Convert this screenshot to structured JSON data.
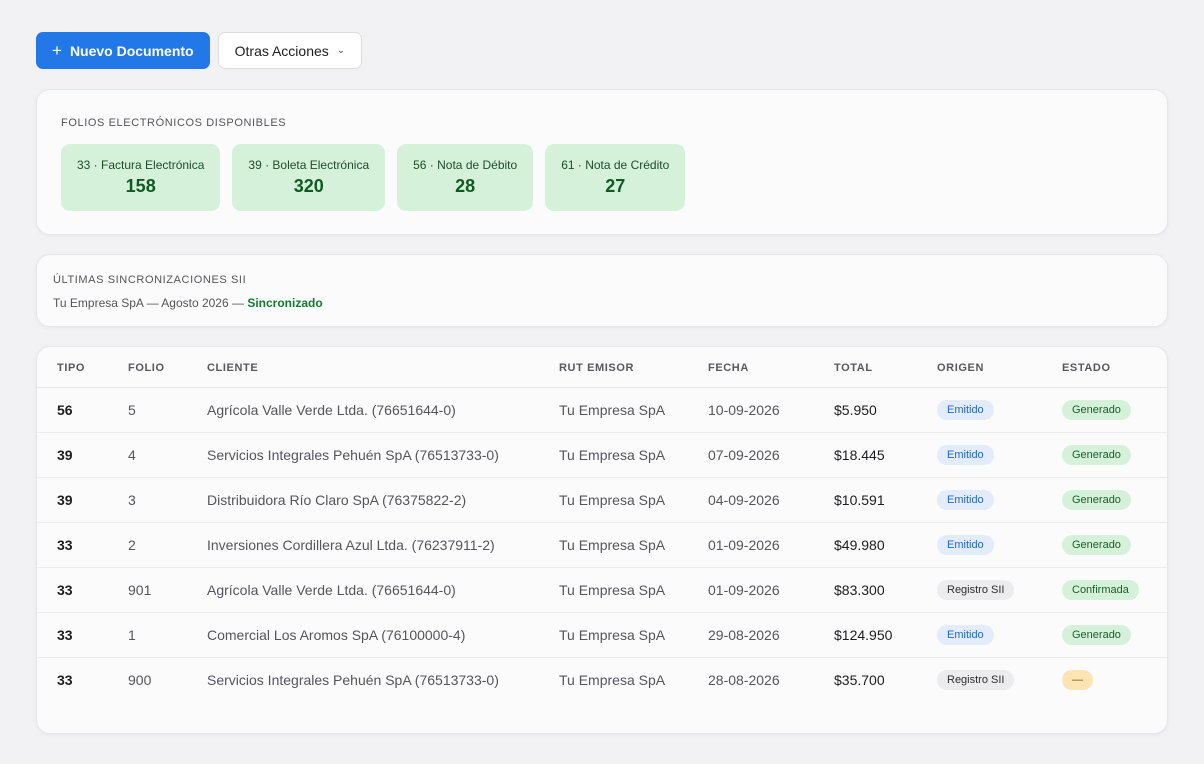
{
  "toolbar": {
    "new_document_icon": "plus-icon",
    "new_document_label": "Nuevo Documento",
    "other_actions_label": "Otras Acciones",
    "other_actions_icon": "chevron-down-icon"
  },
  "folios": {
    "title": "FOLIOS ELECTRÓNICOS DISPONIBLES",
    "items": [
      {
        "label": "33 · Factura Electrónica",
        "count": "158"
      },
      {
        "label": "39 · Boleta Electrónica",
        "count": "320"
      },
      {
        "label": "56 · Nota de Débito",
        "count": "28"
      },
      {
        "label": "61 · Nota de Crédito",
        "count": "27"
      }
    ]
  },
  "sync": {
    "title": "ÚLTIMAS SINCRONIZACIONES SII",
    "description": "Tu Empresa SpA — Agosto 2026 —",
    "status": "Sincronizado"
  },
  "table": {
    "headers": [
      "TIPO",
      "FOLIO",
      "CLIENTE",
      "RUT EMISOR",
      "FECHA",
      "TOTAL",
      "ORIGEN",
      "ESTADO"
    ],
    "rows": [
      {
        "tipo": "56",
        "folio": "5",
        "cliente": "Agrícola Valle Verde Ltda. (76651644-0)",
        "rut_emisor": "Tu Empresa SpA",
        "fecha": "10-09-2026",
        "total": "$5.950",
        "origen": "Emitido",
        "estado": "Generado"
      },
      {
        "tipo": "39",
        "folio": "4",
        "cliente": "Servicios Integrales Pehuén SpA (76513733-0)",
        "rut_emisor": "Tu Empresa SpA",
        "fecha": "07-09-2026",
        "total": "$18.445",
        "origen": "Emitido",
        "estado": "Generado"
      },
      {
        "tipo": "39",
        "folio": "3",
        "cliente": "Distribuidora Río Claro SpA (76375822-2)",
        "rut_emisor": "Tu Empresa SpA",
        "fecha": "04-09-2026",
        "total": "$10.591",
        "origen": "Emitido",
        "estado": "Generado"
      },
      {
        "tipo": "33",
        "folio": "2",
        "cliente": "Inversiones Cordillera Azul Ltda. (76237911-2)",
        "rut_emisor": "Tu Empresa SpA",
        "fecha": "01-09-2026",
        "total": "$49.980",
        "origen": "Emitido",
        "estado": "Generado"
      },
      {
        "tipo": "33",
        "folio": "901",
        "cliente": "Agrícola Valle Verde Ltda. (76651644-0)",
        "rut_emisor": "Tu Empresa SpA",
        "fecha": "01-09-2026",
        "total": "$83.300",
        "origen": "Registro SII",
        "estado": "Confirmada"
      },
      {
        "tipo": "33",
        "folio": "1",
        "cliente": "Comercial Los Aromos SpA (76100000-4)",
        "rut_emisor": "Tu Empresa SpA",
        "fecha": "29-08-2026",
        "total": "$124.950",
        "origen": "Emitido",
        "estado": "Generado"
      },
      {
        "tipo": "33",
        "folio": "900",
        "cliente": "Servicios Integrales Pehuén SpA (76513733-0)",
        "rut_emisor": "Tu Empresa SpA",
        "fecha": "28-08-2026",
        "total": "$35.700",
        "origen": "Registro SII",
        "estado": "—"
      }
    ]
  }
}
